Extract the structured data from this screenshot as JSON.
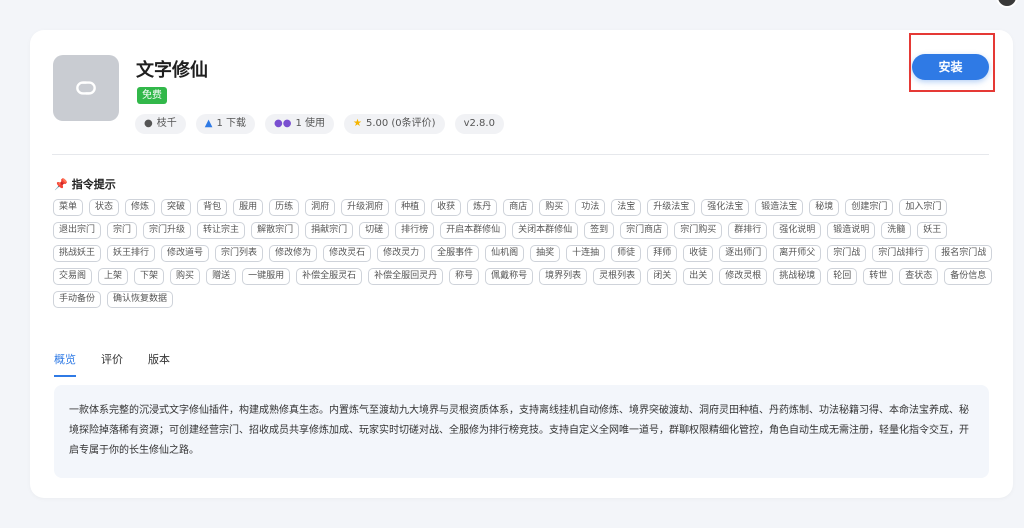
{
  "plugin": {
    "title": "文字修仙",
    "badge": "免费",
    "meta": [
      {
        "icon": "user-icon",
        "label": "枝千"
      },
      {
        "icon": "download-icon",
        "label": "1 下载"
      },
      {
        "icon": "users-icon",
        "label": "1 使用"
      },
      {
        "icon": "star-icon",
        "label": "5.00 (0条评价)"
      },
      {
        "icon": "",
        "label": "v2.8.0"
      }
    ],
    "install_label": "安装"
  },
  "commands": {
    "title": "指令提示",
    "items": [
      "菜单",
      "状态",
      "修炼",
      "突破",
      "背包",
      "服用",
      "历练",
      "洞府",
      "升级洞府",
      "种植",
      "收获",
      "炼丹",
      "商店",
      "购买",
      "功法",
      "法宝",
      "升级法宝",
      "强化法宝",
      "锻造法宝",
      "秘境",
      "创建宗门",
      "加入宗门",
      "退出宗门",
      "宗门",
      "宗门升级",
      "转让宗主",
      "解散宗门",
      "捐献宗门",
      "切磋",
      "排行榜",
      "开启本群修仙",
      "关闭本群修仙",
      "签到",
      "宗门商店",
      "宗门购买",
      "群排行",
      "强化说明",
      "锻造说明",
      "洗髓",
      "妖王",
      "挑战妖王",
      "妖王排行",
      "修改道号",
      "宗门列表",
      "修改修为",
      "修改灵石",
      "修改灵力",
      "全服事件",
      "仙机阁",
      "抽奖",
      "十连抽",
      "师徒",
      "拜师",
      "收徒",
      "逐出师门",
      "离开师父",
      "宗门战",
      "宗门战排行",
      "报名宗门战",
      "交易阁",
      "上架",
      "下架",
      "购买",
      "赠送",
      "一键服用",
      "补偿全服灵石",
      "补偿全服回灵丹",
      "称号",
      "佩戴称号",
      "境界列表",
      "灵根列表",
      "闭关",
      "出关",
      "修改灵根",
      "挑战秘境",
      "轮回",
      "转世",
      "查状态",
      "备份信息",
      "手动备份",
      "确认恢复数据"
    ]
  },
  "tabs": [
    {
      "label": "概览",
      "active": true
    },
    {
      "label": "评价",
      "active": false
    },
    {
      "label": "版本",
      "active": false
    }
  ],
  "description": "一款体系完整的沉浸式文字修仙插件，构建成熟修真生态。内置炼气至渡劫九大境界与灵根资质体系，支持离线挂机自动修炼、境界突破渡劫、洞府灵田种植、丹药炼制、功法秘籍习得、本命法宝养成、秘境探险掉落稀有资源；可创建经营宗门、招收成员共享修炼加成、玩家实时切磋对战、全服修为排行榜竞技。支持自定义全网唯一道号，群聊权限精细化管控，角色自动生成无需注册，轻量化指令交互，开启专属于你的长生修仙之路。"
}
